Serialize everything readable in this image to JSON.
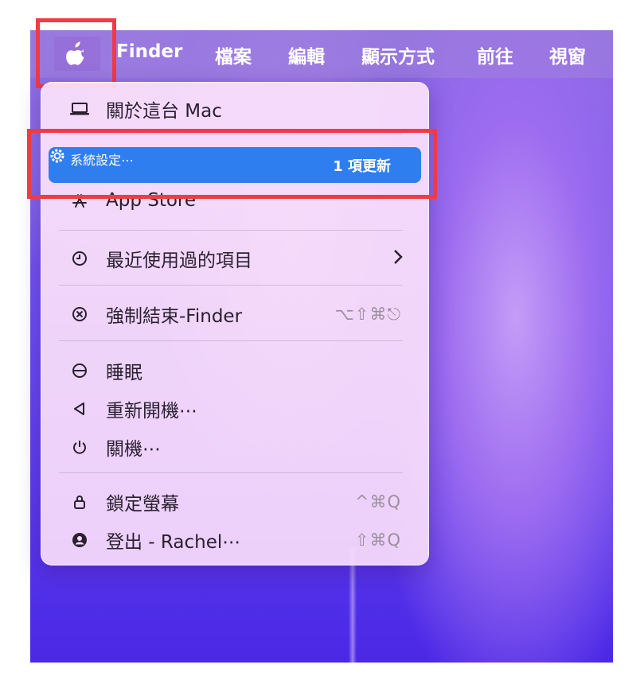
{
  "menubar": {
    "app_name": "Finder",
    "items": [
      "檔案",
      "編輯",
      "顯示方式",
      "前往",
      "視窗"
    ]
  },
  "apple_menu": {
    "about": "關於這台 Mac",
    "system_settings": "系統設定⋯",
    "system_settings_badge": "1 項更新",
    "app_store": "App Store",
    "recent_items": "最近使用過的項目",
    "force_quit": "強制結束-Finder",
    "force_quit_shortcut": "⌥⇧⌘⎋",
    "sleep": "睡眠",
    "restart": "重新開機⋯",
    "shutdown": "關機⋯",
    "lock_screen": "鎖定螢幕",
    "lock_screen_shortcut": "^⌘Q",
    "logout": "登出 - Rachel⋯",
    "logout_shortcut": "⇧⌘Q"
  },
  "colors": {
    "highlight": "#2e7ef0",
    "annotation": "#ef3b46"
  }
}
